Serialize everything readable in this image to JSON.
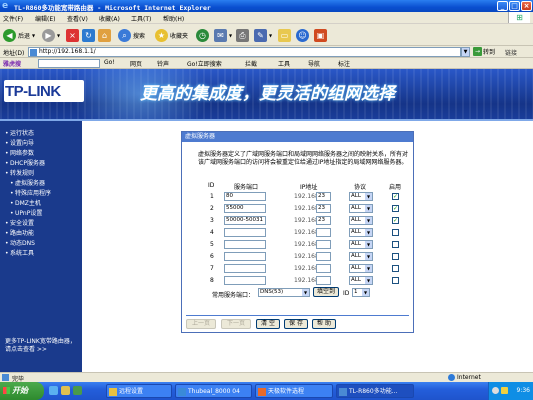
{
  "window": {
    "title": "TL-R860多功能宽带路由器 - Microsoft Internet Explorer"
  },
  "menu": [
    "文件(F)",
    "编辑(E)",
    "查看(V)",
    "收藏(A)",
    "工具(T)",
    "帮助(H)"
  ],
  "toolbar": {
    "back": "后退",
    "search": "搜索",
    "favorites": "收藏夹"
  },
  "address": {
    "label": "地址(D)",
    "url": "http://192.168.1.1/",
    "go": "转到",
    "links": "链接"
  },
  "searchbar": {
    "brand": "雅虎搜",
    "go": "Go!",
    "web": "网页",
    "ring": "铃声",
    "mp3": "Go!立即搜索",
    "block": "拦截",
    "tools": "工具",
    "nav": "导航",
    "mark": "标注"
  },
  "banner": {
    "logo": "TP-LINK",
    "slogan": "更高的集成度，更灵活的组网选择"
  },
  "sidebar": {
    "items": [
      {
        "label": "运行状态",
        "sub": false
      },
      {
        "label": "设置向导",
        "sub": false
      },
      {
        "label": "网络参数",
        "sub": false
      },
      {
        "label": "DHCP服务器",
        "sub": false
      },
      {
        "label": "转发规则",
        "sub": false
      },
      {
        "label": "虚拟服务器",
        "sub": true
      },
      {
        "label": "特殊应用程序",
        "sub": true
      },
      {
        "label": "DMZ主机",
        "sub": true
      },
      {
        "label": "UPnP设置",
        "sub": true
      },
      {
        "label": "安全设置",
        "sub": false
      },
      {
        "label": "路由功能",
        "sub": false
      },
      {
        "label": "动态DNS",
        "sub": false
      },
      {
        "label": "系统工具",
        "sub": false
      }
    ],
    "more": "更多TP-LINK宽带路由器，请点击查看 >>"
  },
  "panel": {
    "title": "虚拟服务器",
    "description": "虚拟服务器定义了广域网服务端口和局域网网络服务器之间的映射关系，所有对该广域网服务端口的访问将会被重定位给通过IP地址指定的局域网网络服务器。",
    "headers": {
      "id": "ID",
      "port": "服务端口",
      "ip": "IP地址",
      "protocol": "协议",
      "enable": "启用"
    },
    "ip_prefix": "192.168.1.",
    "rows": [
      {
        "id": "1",
        "port": "80",
        "ip_last": "23",
        "protocol": "ALL",
        "enabled": true
      },
      {
        "id": "2",
        "port": "55000",
        "ip_last": "23",
        "protocol": "ALL",
        "enabled": true
      },
      {
        "id": "3",
        "port": "50000-50031",
        "ip_last": "23",
        "protocol": "ALL",
        "enabled": true
      },
      {
        "id": "4",
        "port": "",
        "ip_last": "",
        "protocol": "ALL",
        "enabled": false
      },
      {
        "id": "5",
        "port": "",
        "ip_last": "",
        "protocol": "ALL",
        "enabled": false
      },
      {
        "id": "6",
        "port": "",
        "ip_last": "",
        "protocol": "ALL",
        "enabled": false
      },
      {
        "id": "7",
        "port": "",
        "ip_last": "",
        "protocol": "ALL",
        "enabled": false
      },
      {
        "id": "8",
        "port": "",
        "ip_last": "",
        "protocol": "ALL",
        "enabled": false
      }
    ],
    "common_label": "常用服务端口：",
    "common_value": "DNS(53)",
    "fill_button": "填空到",
    "id_label": "ID",
    "id_value": "1",
    "buttons": {
      "prev": "上一页",
      "next": "下一页",
      "clear": "清 空",
      "save": "保 存",
      "help": "帮 助"
    }
  },
  "status": {
    "text": "完毕",
    "zone": "Internet"
  },
  "taskbar": {
    "start": "开始",
    "tasks": [
      "远程设置",
      "Thubeal_8000 04",
      "天极软件选程",
      "TL-R860多功能..."
    ],
    "clock": "9:36"
  }
}
